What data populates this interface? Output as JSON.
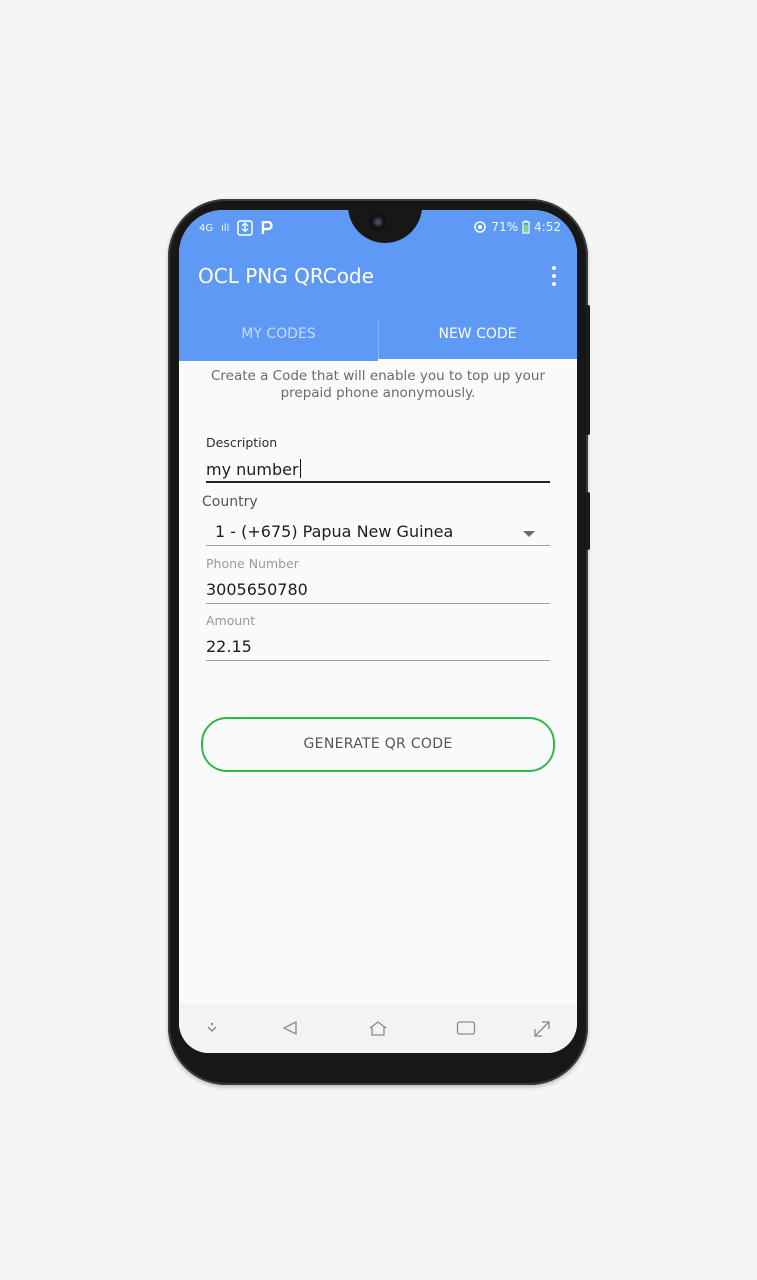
{
  "status_bar": {
    "network": "4G",
    "signal": "ıll",
    "battery": "71%",
    "time": "4:52"
  },
  "app": {
    "title": "OCL PNG QRCode",
    "menu_icon": "overflow-menu-icon"
  },
  "tabs": [
    {
      "label": "MY CODES",
      "active": false
    },
    {
      "label": "NEW CODE",
      "active": true
    }
  ],
  "form": {
    "intro": "Create a Code that will enable you to top up your prepaid phone anonymously.",
    "description": {
      "label": "Description",
      "value": "my number"
    },
    "country": {
      "label": "Country",
      "selected": "1 - (+675) Papua New Guinea"
    },
    "phone": {
      "label": "Phone Number",
      "value": "3005650780"
    },
    "amount": {
      "label": "Amount",
      "value": "22.15"
    },
    "generate_button": "GENERATE QR CODE"
  },
  "nav_bar": {
    "icons": [
      "hide-keyboard-icon",
      "back-icon",
      "home-icon",
      "recents-icon",
      "expand-icon"
    ]
  },
  "colors": {
    "app_bar": "#5e99f6",
    "button_border": "#2db84a"
  }
}
